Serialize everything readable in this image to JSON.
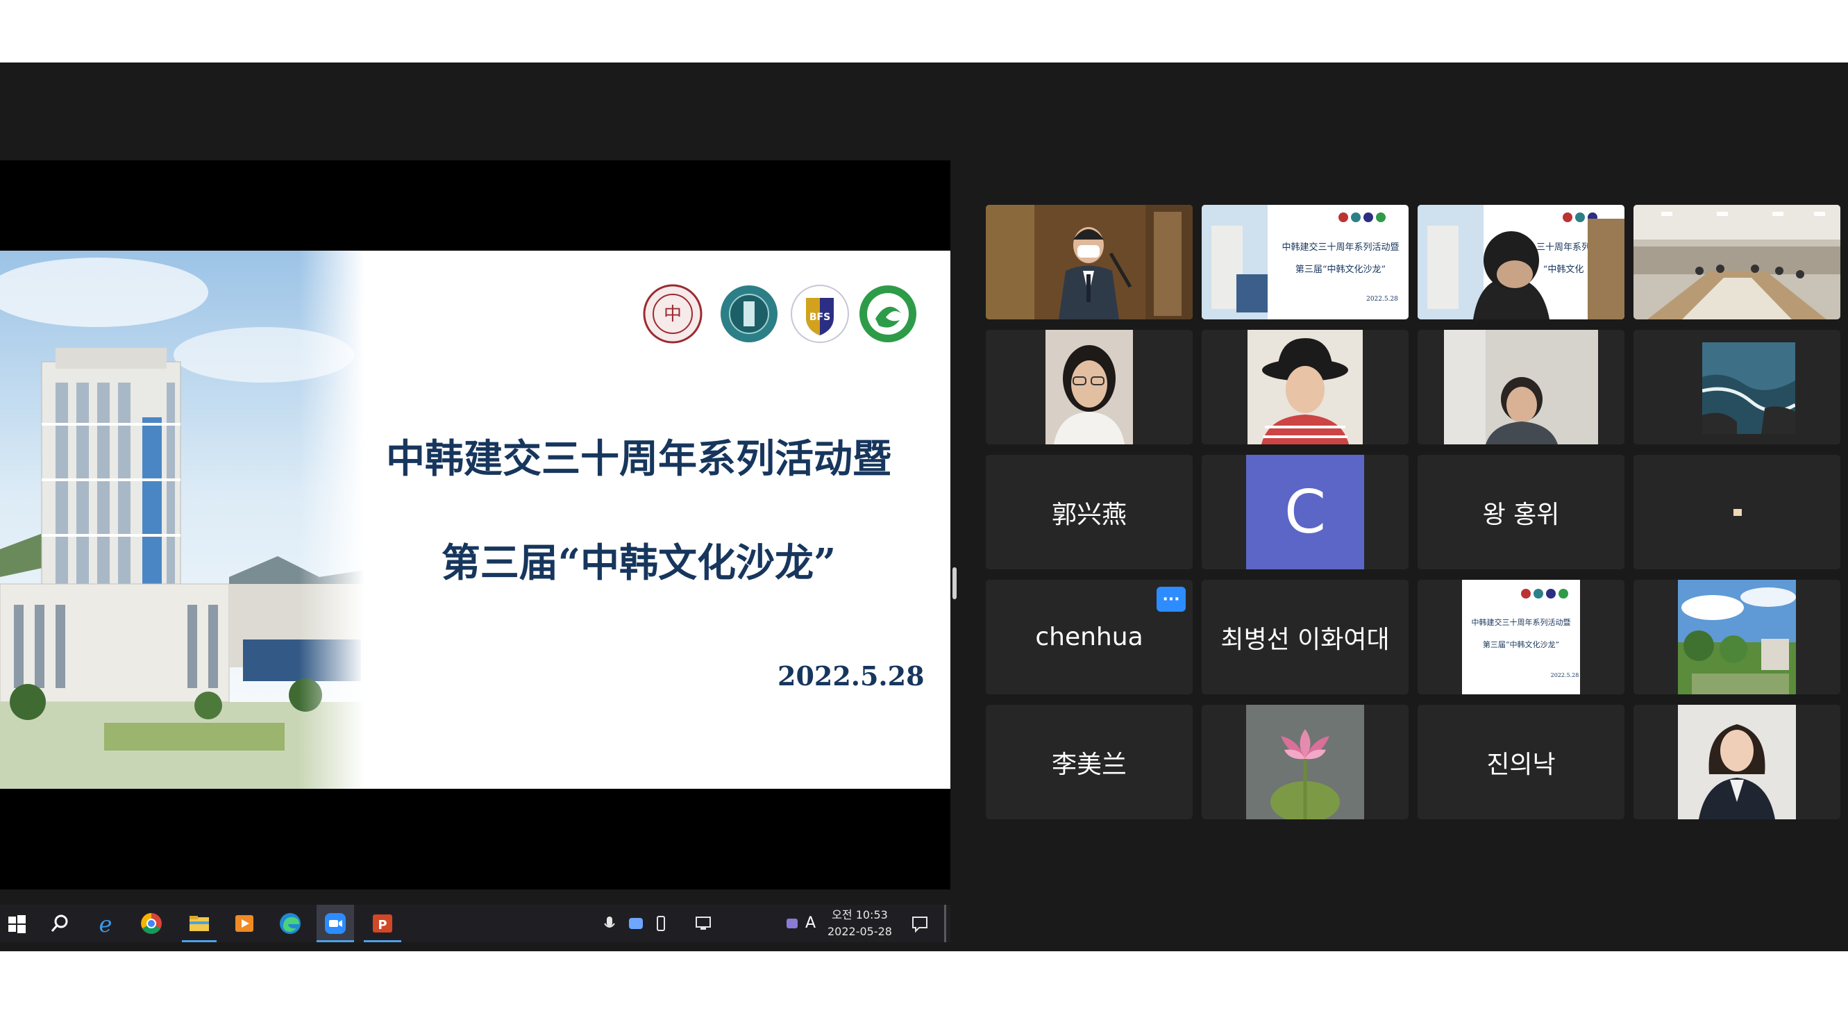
{
  "slide": {
    "title_line1": "中韩建交三十周年系列活动暨",
    "title_line2": "第三届“中韩文化沙龙”",
    "date": "2022.5.28"
  },
  "taskbar": {
    "icons": [
      "windows-start-icon",
      "search-icon",
      "internet-explorer-icon",
      "chrome-icon",
      "file-explorer-icon",
      "media-player-icon",
      "edge-icon",
      "zoom-icon",
      "powerpoint-icon"
    ],
    "tray_icons": [
      "microphone-icon",
      "zoom-tray-icon",
      "usb-icon",
      "network-icon",
      "security-icon"
    ],
    "ime": "A",
    "clock_time": "오전 10:53",
    "clock_date": "2022-05-28"
  },
  "participants": [
    {
      "id": "speaker-video",
      "kind": "video",
      "active": true
    },
    {
      "id": "slide-share-video",
      "kind": "video"
    },
    {
      "id": "slide-person-video",
      "kind": "video"
    },
    {
      "id": "conference-room-video",
      "kind": "video"
    },
    {
      "id": "woman-glasses-video",
      "kind": "video"
    },
    {
      "id": "woman-hat-video",
      "kind": "video"
    },
    {
      "id": "woman-blurred-video",
      "kind": "video"
    },
    {
      "id": "ocean-rocks-picture",
      "kind": "video"
    },
    {
      "id": "name-tile",
      "kind": "name",
      "name": "郭兴燕"
    },
    {
      "id": "avatar-tile",
      "kind": "avatar",
      "letter": "C",
      "color": "#5b66c6"
    },
    {
      "id": "name-tile",
      "kind": "name",
      "name": "왕 홍위"
    },
    {
      "id": "tiny-video",
      "kind": "video"
    },
    {
      "id": "name-tile",
      "kind": "name",
      "name": "chenhua",
      "more_button": true
    },
    {
      "id": "name-tile",
      "kind": "name",
      "name": "최병선 이화여대"
    },
    {
      "id": "slide-thumbnail",
      "kind": "video"
    },
    {
      "id": "campus-picture",
      "kind": "video"
    },
    {
      "id": "name-tile",
      "kind": "name",
      "name": "李美兰"
    },
    {
      "id": "lotus-picture",
      "kind": "video"
    },
    {
      "id": "name-tile",
      "kind": "name",
      "name": "진의낙"
    },
    {
      "id": "woman-portrait-picture",
      "kind": "video"
    }
  ],
  "thumb_slide": {
    "line1": "中韩建交三十周年系列活动暨",
    "line2": "第三届“中韩文化沙龙”",
    "date": "2022.5.28",
    "line1_short": "三十周年系列",
    "line2_short": "“中韩文化"
  },
  "more_button_label": "···"
}
